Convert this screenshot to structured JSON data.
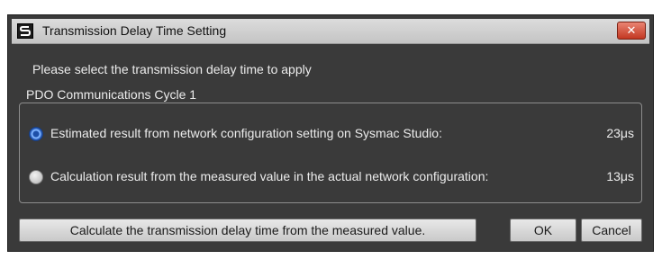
{
  "window": {
    "title": "Transmission Delay Time Setting",
    "close_label": "✕"
  },
  "dialog": {
    "prompt": "Please select the transmission delay time to apply",
    "group_title": "PDO Communications Cycle 1",
    "options": [
      {
        "label": "Estimated result from network configuration setting on Sysmac Studio:",
        "value": "23μs",
        "selected": true
      },
      {
        "label": "Calculation result from the measured value in the actual network configuration:",
        "value": "13μs",
        "selected": false
      }
    ]
  },
  "buttons": {
    "calculate": "Calculate the transmission delay time from the measured value.",
    "ok": "OK",
    "cancel": "Cancel"
  },
  "colors": {
    "window_background": "#3a3a3a",
    "title_bar": "#d2d2d2",
    "close_button": "#d9503c",
    "radio_selected": "#2a5db8"
  }
}
